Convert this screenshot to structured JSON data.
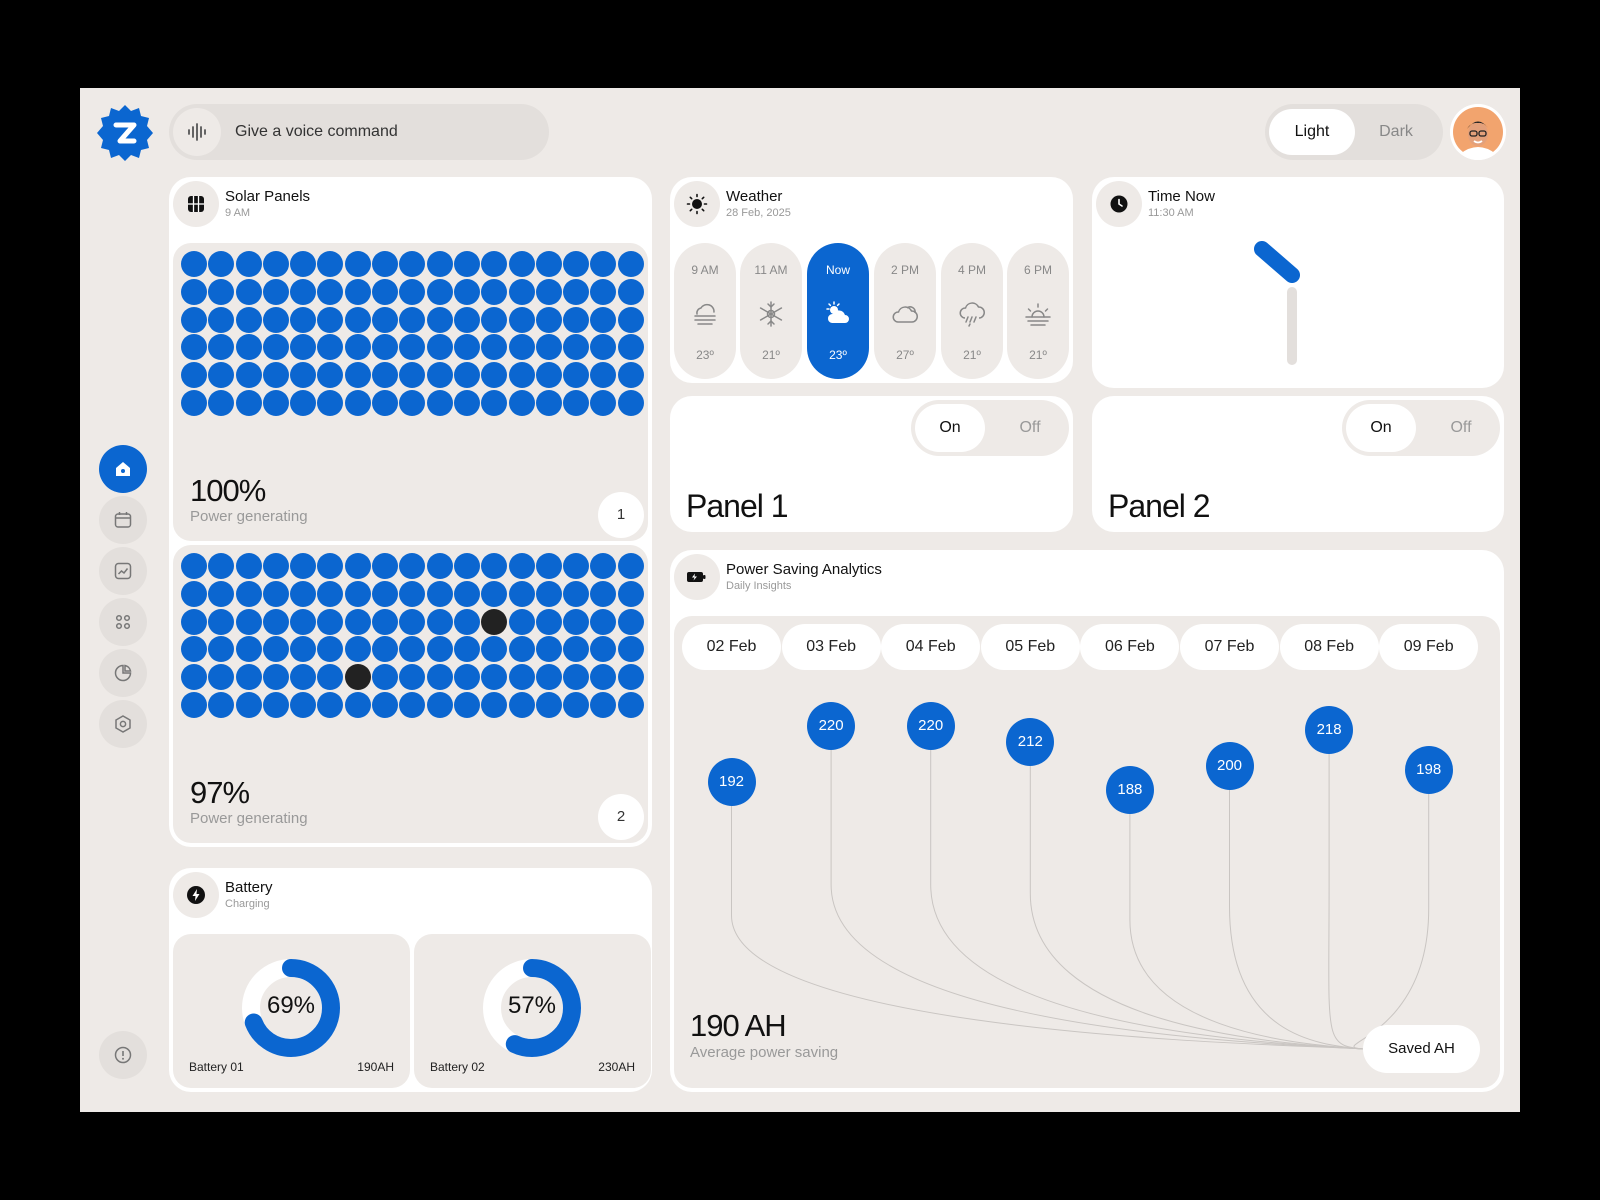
{
  "app": {
    "voice_placeholder": "Give a voice command",
    "theme_light": "Light",
    "theme_dark": "Dark",
    "accent": "#0b66d0"
  },
  "sidebar": {
    "items": [
      {
        "icon": "home-icon",
        "active": true
      },
      {
        "icon": "calendar-icon"
      },
      {
        "icon": "analytics-icon"
      },
      {
        "icon": "apps-icon"
      },
      {
        "icon": "pie-chart-icon"
      },
      {
        "icon": "settings-icon"
      }
    ],
    "bottom_icon": "info-icon"
  },
  "solar": {
    "title": "Solar Panels",
    "subtitle": "9 AM",
    "panels": [
      {
        "percent": "100%",
        "label": "Power generating",
        "number": "1",
        "dark_cells": []
      },
      {
        "percent": "97%",
        "label": "Power generating",
        "number": "2",
        "dark_cells": [
          [
            2,
            11
          ],
          [
            4,
            6
          ]
        ]
      }
    ]
  },
  "weather": {
    "title": "Weather",
    "date": "28 Feb, 2025",
    "hours": [
      {
        "time": "9 AM",
        "temp": "23º",
        "icon": "fog-icon"
      },
      {
        "time": "11 AM",
        "temp": "21º",
        "icon": "snowflake-icon"
      },
      {
        "time": "Now",
        "temp": "23º",
        "icon": "partly-cloudy-icon",
        "current": true
      },
      {
        "time": "2 PM",
        "temp": "27º",
        "icon": "cloudy-icon"
      },
      {
        "time": "4 PM",
        "temp": "21º",
        "icon": "rain-icon"
      },
      {
        "time": "6 PM",
        "temp": "21º",
        "icon": "sunset-icon"
      }
    ]
  },
  "time": {
    "title": "Time Now",
    "value": "11:30 AM"
  },
  "panel_controls": [
    {
      "name": "Panel 1",
      "on": "On",
      "off": "Off"
    },
    {
      "name": "Panel 2",
      "on": "On",
      "off": "Off"
    }
  ],
  "analytics": {
    "title": "Power Saving Analytics",
    "subtitle": "Daily Insights",
    "average_value": "190 AH",
    "average_label": "Average power saving",
    "end_label": "Saved AH"
  },
  "chart_data": {
    "type": "scatter",
    "categories": [
      "02 Feb",
      "03 Feb",
      "04 Feb",
      "05 Feb",
      "06 Feb",
      "07 Feb",
      "08 Feb",
      "09 Feb"
    ],
    "values": [
      192,
      220,
      220,
      212,
      188,
      200,
      218,
      198
    ]
  },
  "battery": {
    "title": "Battery",
    "subtitle": "Charging",
    "items": [
      {
        "percent": 69,
        "label": "69%",
        "name": "Battery 01",
        "capacity": "190AH"
      },
      {
        "percent": 57,
        "label": "57%",
        "name": "Battery 02",
        "capacity": "230AH"
      }
    ]
  }
}
